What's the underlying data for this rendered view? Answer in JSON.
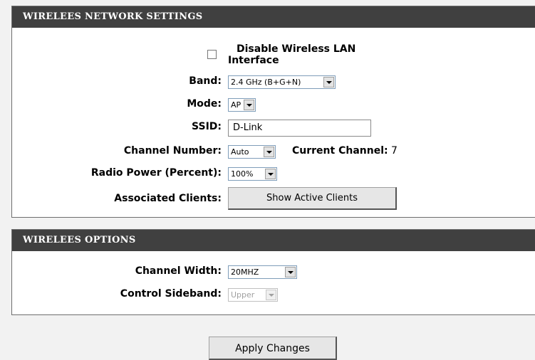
{
  "network_settings": {
    "title": "WIRELEES NETWORK SETTINGS",
    "disable_wlan_label_line1": "Disable Wireless LAN",
    "disable_wlan_label_line2": "Interface",
    "disable_wlan_checked": false,
    "band_label": "Band:",
    "band_value": "2.4 GHz (B+G+N)",
    "mode_label": "Mode:",
    "mode_value": "AP",
    "ssid_label": "SSID:",
    "ssid_value": "D-Link",
    "channel_number_label": "Channel Number:",
    "channel_number_value": "Auto",
    "current_channel_label": "Current Channel:",
    "current_channel_value": "7",
    "radio_power_label": "Radio Power (Percent):",
    "radio_power_value": "100%",
    "associated_clients_label": "Associated Clients:",
    "show_active_clients_button": "Show Active Clients"
  },
  "wireless_options": {
    "title": "WIRELEES OPTIONS",
    "channel_width_label": "Channel Width:",
    "channel_width_value": "20MHZ",
    "control_sideband_label": "Control Sideband:",
    "control_sideband_value": "Upper"
  },
  "apply_button": "Apply Changes"
}
